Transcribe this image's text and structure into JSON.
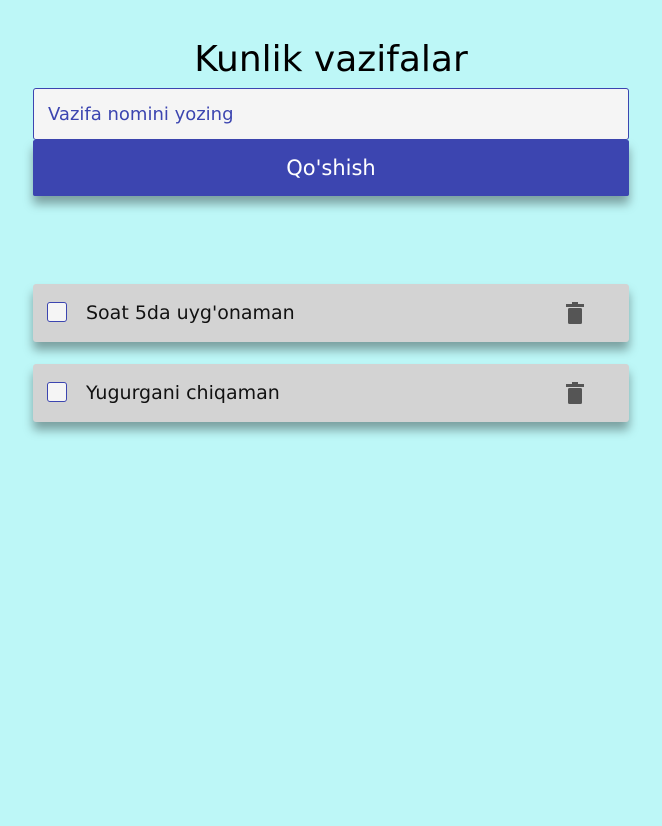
{
  "header": {
    "title": "Kunlik vazifalar"
  },
  "form": {
    "input_placeholder": "Vazifa nomini yozing",
    "input_value": "",
    "add_button_label": "Qo'shish"
  },
  "tasks": [
    {
      "label": "Soat 5da uyg'onaman",
      "checked": false,
      "delete_icon": "trash-icon"
    },
    {
      "label": "Yugurgani chiqaman",
      "checked": false,
      "delete_icon": "trash-icon"
    }
  ],
  "colors": {
    "background": "#bdf7f7",
    "accent": "#3c45b0",
    "task_background": "#d3d3d3",
    "input_background": "#f5f5f5",
    "icon": "#555555"
  }
}
